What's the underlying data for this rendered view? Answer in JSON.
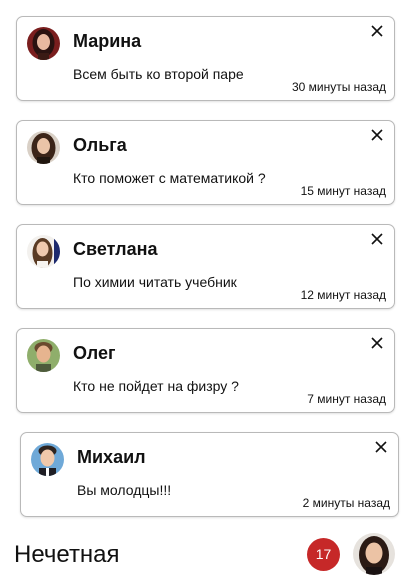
{
  "notifications": [
    {
      "name": "Марина",
      "message": "Всем быть ко второй паре",
      "time": "30 минуты назад",
      "avatar_icon": "dark-haired-woman-avatar"
    },
    {
      "name": "Ольга",
      "message": "Кто поможет с математикой ?",
      "time": "15 минут назад",
      "avatar_icon": "brunette-woman-avatar"
    },
    {
      "name": "Светлана",
      "message": "По химии читать учебник",
      "time": "12 минут назад",
      "avatar_icon": "long-haired-woman-avatar"
    },
    {
      "name": "Олег",
      "message": "Кто не пойдет на физру ?",
      "time": "7 минут назад",
      "avatar_icon": "young-man-avatar"
    },
    {
      "name": "Михаил",
      "message": "Вы молодцы!!!",
      "time": "2 минуты назад",
      "avatar_icon": "man-avatar"
    }
  ],
  "close_icon": "close-icon",
  "footer": {
    "title": "Нечетная",
    "badge_count": "17",
    "badge_color": "#c62828",
    "user_avatar_icon": "user-avatar"
  }
}
